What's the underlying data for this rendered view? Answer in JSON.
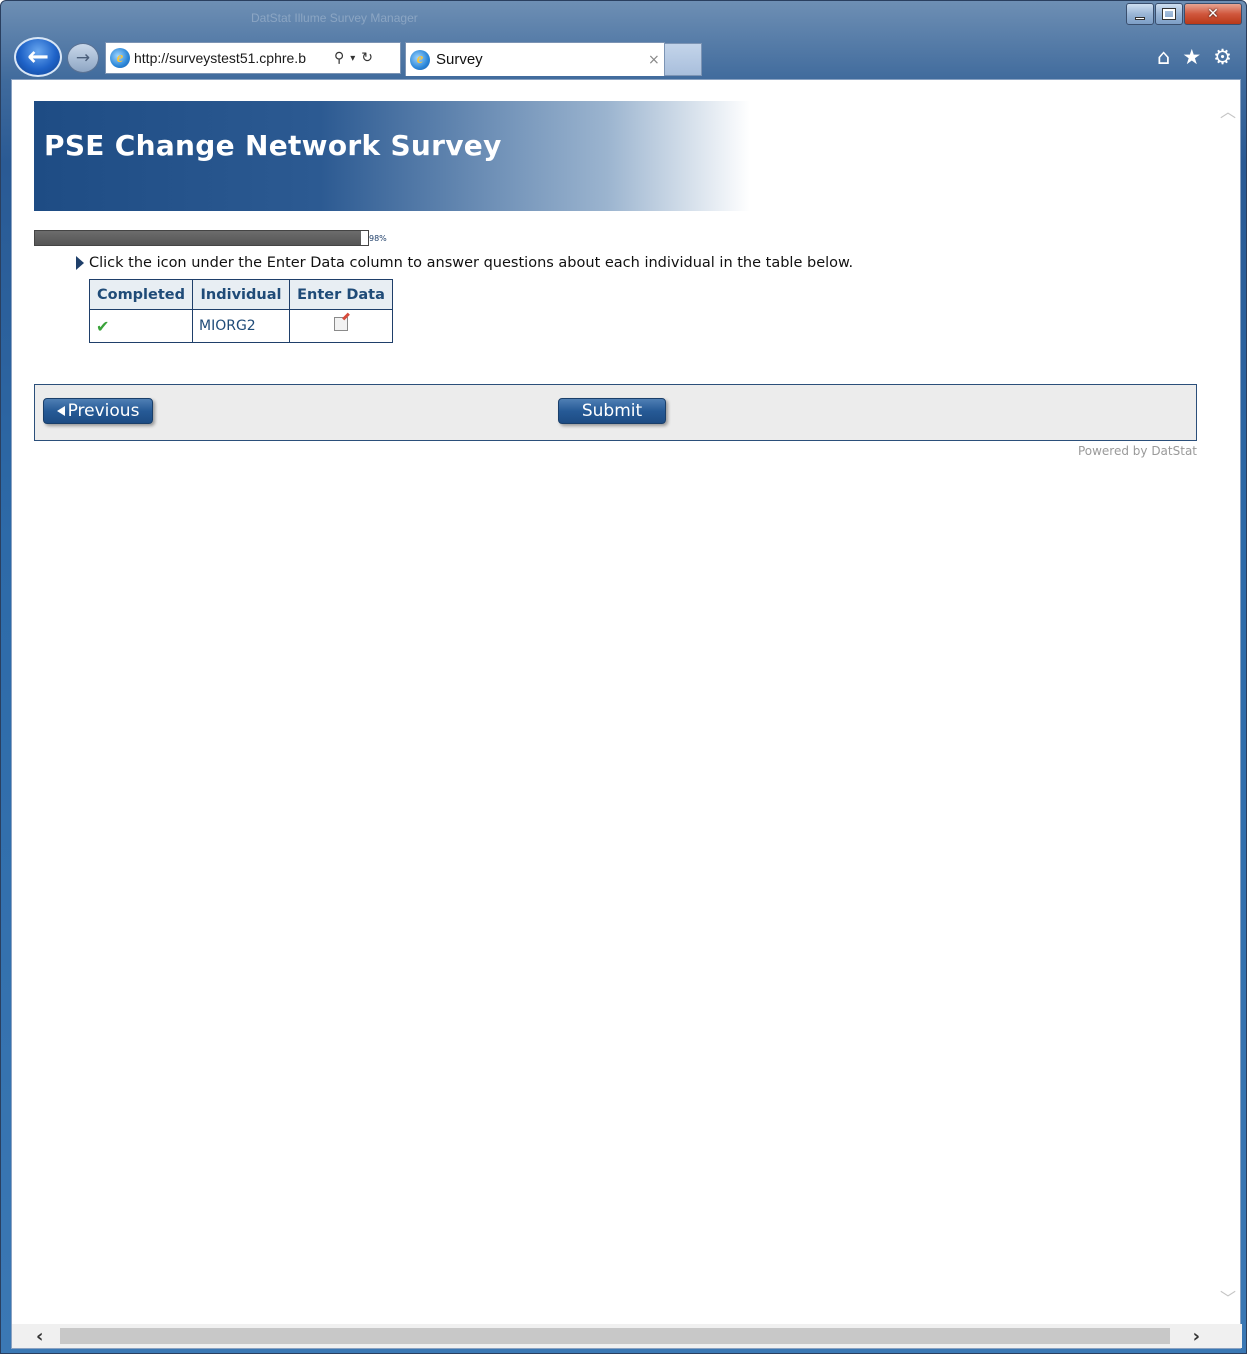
{
  "browser": {
    "window_title": "DatStat Illume Survey Manager",
    "address_url": "http://surveystest51.cphre.b",
    "tab_title": "Survey",
    "tab_close": "×",
    "icons": [
      "back-arrow-icon",
      "forward-arrow-icon",
      "ie-logo-icon",
      "search-icon",
      "dropdown-icon",
      "refresh-icon",
      "home-icon",
      "favorites-star-icon",
      "settings-gear-icon"
    ]
  },
  "page": {
    "banner_title": "PSE Change Network Survey",
    "progress_percent": 98,
    "progress_label": "98%",
    "instruction": "Click the icon under the Enter Data column to answer questions about each individual in the table below.",
    "table": {
      "headers": [
        "Completed",
        "Individual",
        "Enter Data"
      ],
      "rows": [
        {
          "completed": true,
          "individual": "MIORG2",
          "enter_data_icon": "edit-icon"
        }
      ]
    },
    "buttons": {
      "previous_label": "Previous",
      "submit_label": "Submit"
    },
    "powered_by": "Powered by DatStat"
  },
  "colors": {
    "banner": "#2c5a92",
    "header_text": "#1f4b78",
    "button": "#265a96",
    "check": "#3aa33a"
  }
}
